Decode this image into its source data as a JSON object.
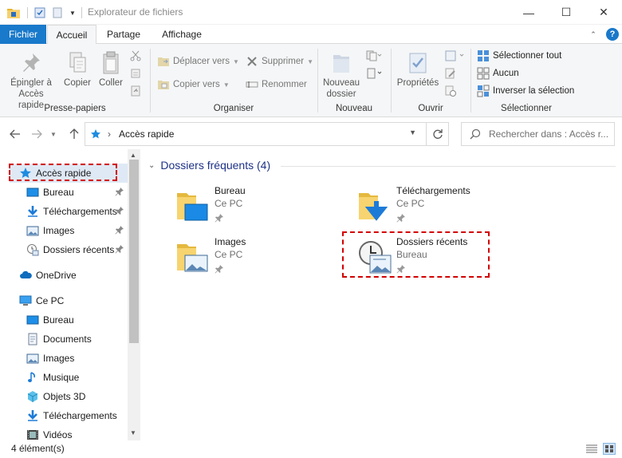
{
  "window": {
    "title": "Explorateur de fichiers",
    "controls": {
      "minimize": "—",
      "maximize": "☐",
      "close": "✕"
    }
  },
  "tabs": {
    "file": "Fichier",
    "home": "Accueil",
    "share": "Partage",
    "view": "Affichage",
    "help": "?"
  },
  "ribbon": {
    "clipboard": {
      "label": "Presse-papiers",
      "pin_line1": "Épingler à",
      "pin_line2": "Accès rapide",
      "copy": "Copier",
      "paste": "Coller"
    },
    "organize": {
      "label": "Organiser",
      "move_to": "Déplacer vers",
      "copy_to": "Copier vers",
      "delete": "Supprimer",
      "rename": "Renommer"
    },
    "new": {
      "label": "Nouveau",
      "new_folder_line1": "Nouveau",
      "new_folder_line2": "dossier"
    },
    "open": {
      "label": "Ouvrir",
      "properties": "Propriétés"
    },
    "select": {
      "label": "Sélectionner",
      "select_all": "Sélectionner tout",
      "select_none": "Aucun",
      "invert": "Inverser la sélection"
    }
  },
  "address": {
    "separator": "›",
    "path": "Accès rapide",
    "search_placeholder": "Rechercher dans : Accès r..."
  },
  "sidebar": {
    "items": [
      {
        "label": "Accès rapide",
        "icon": "star-icon"
      },
      {
        "label": "Bureau",
        "icon": "desktop-icon",
        "pinned": true
      },
      {
        "label": "Téléchargements",
        "icon": "download-icon",
        "pinned": true
      },
      {
        "label": "Images",
        "icon": "pictures-icon",
        "pinned": true
      },
      {
        "label": "Dossiers récents",
        "icon": "recent-icon",
        "pinned": true
      },
      {
        "label": "OneDrive",
        "icon": "cloud-icon"
      },
      {
        "label": "Ce PC",
        "icon": "pc-icon"
      },
      {
        "label": "Bureau",
        "icon": "desktop-icon"
      },
      {
        "label": "Documents",
        "icon": "documents-icon"
      },
      {
        "label": "Images",
        "icon": "pictures-icon"
      },
      {
        "label": "Musique",
        "icon": "music-icon"
      },
      {
        "label": "Objets 3D",
        "icon": "cube-icon"
      },
      {
        "label": "Téléchargements",
        "icon": "download-icon"
      },
      {
        "label": "Vidéos",
        "icon": "video-icon"
      }
    ]
  },
  "main": {
    "section_title": "Dossiers fréquents (4)",
    "tiles": [
      {
        "name": "Bureau",
        "location": "Ce PC"
      },
      {
        "name": "Téléchargements",
        "location": "Ce PC"
      },
      {
        "name": "Images",
        "location": "Ce PC"
      },
      {
        "name": "Dossiers récents",
        "location": "Bureau"
      }
    ]
  },
  "status": {
    "count": "4 élément(s)"
  },
  "colors": {
    "accent": "#1979ca",
    "highlight": "#d40000",
    "section_title": "#1e3287"
  }
}
